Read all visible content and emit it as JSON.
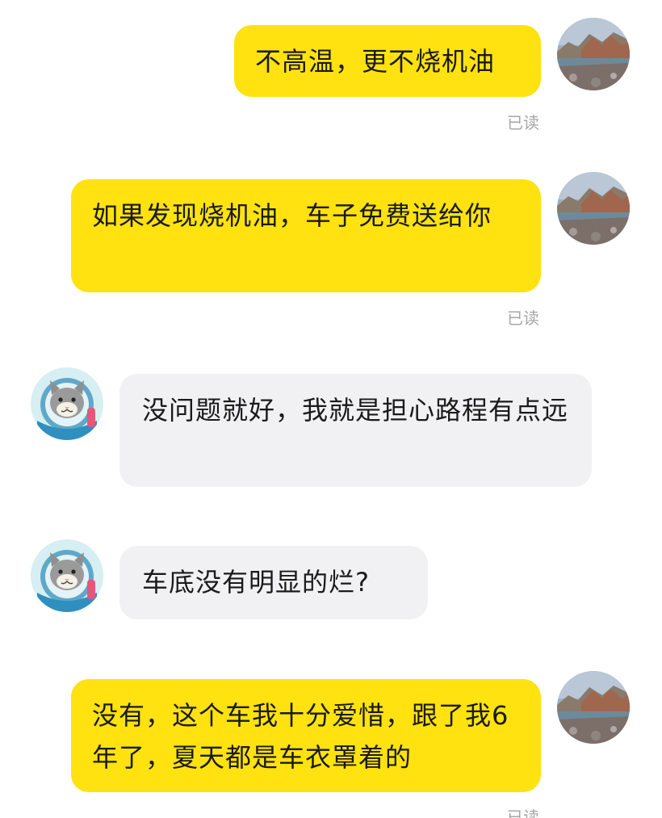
{
  "conversation": {
    "messages": [
      {
        "sender": "self",
        "text": "不高温，更不烧机油",
        "status": "已读",
        "avatar": "landscape-avatar-icon"
      },
      {
        "sender": "self",
        "text": "如果发现烧机油，车子免费送给你",
        "status": "已读",
        "avatar": "landscape-avatar-icon"
      },
      {
        "sender": "other",
        "text": "没问题就好，我就是担心路程有点远",
        "avatar": "cat-astronaut-avatar-icon"
      },
      {
        "sender": "other",
        "text": "车底没有明显的烂?",
        "avatar": "cat-astronaut-avatar-icon"
      },
      {
        "sender": "self",
        "text": "没有，这个车我十分爱惜，跟了我6年了，夏天都是车衣罩着的",
        "status": "已读",
        "avatar": "landscape-avatar-icon"
      }
    ]
  },
  "colors": {
    "self_bubble": "#ffe20f",
    "other_bubble": "#f1f1f3",
    "read_status": "#a6a6a6",
    "text": "#1a1a1a"
  }
}
